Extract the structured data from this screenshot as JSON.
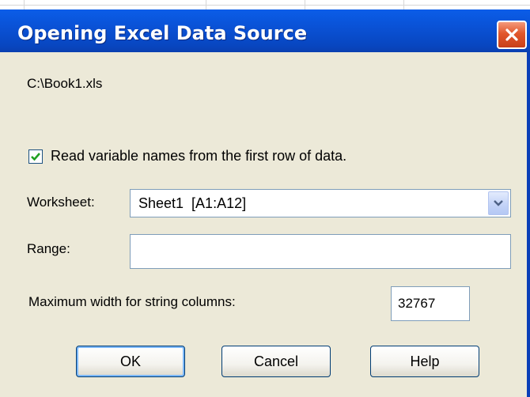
{
  "window": {
    "title": "Opening Excel Data Source"
  },
  "dialog": {
    "file_path": "C:\\Book1.xls",
    "read_names": {
      "checked": true,
      "label": "Read variable names from the first row of data."
    },
    "worksheet": {
      "label": "Worksheet:",
      "selected": "Sheet1  [A1:A12]"
    },
    "range": {
      "label": "Range:",
      "value": ""
    },
    "max_width": {
      "label": "Maximum width for string columns:",
      "value": "32767"
    },
    "buttons": {
      "ok": "OK",
      "cancel": "Cancel",
      "help": "Help"
    }
  },
  "colors": {
    "titlebar": "#0a52d6",
    "dialog_bg": "#ece9d8",
    "close_button": "#e2572c",
    "check_mark": "#21a121"
  },
  "icons": {
    "close": "close-icon",
    "checkmark": "checkmark-icon",
    "dropdown": "chevron-down-icon"
  }
}
